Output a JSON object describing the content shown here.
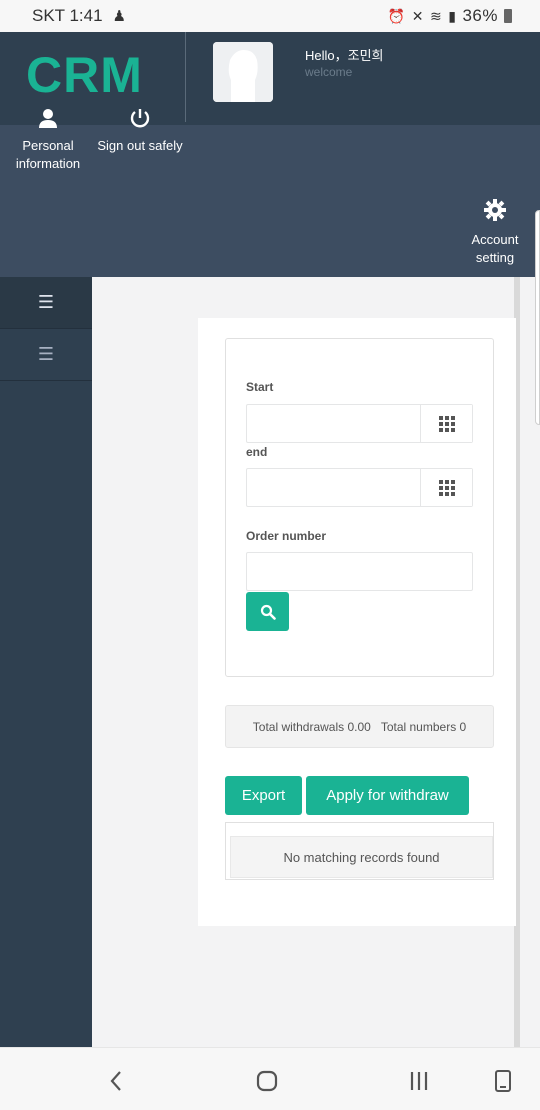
{
  "status": {
    "carrier_time": "SKT 1:41",
    "battery": "36%"
  },
  "header": {
    "logo": "CRM",
    "hello": "Hello，조민희",
    "welcome": "welcome",
    "personal_info": "Personal information",
    "sign_out": "Sign out safely",
    "account_setting": "Account setting"
  },
  "form": {
    "start_label": "Start",
    "end_label": "end",
    "order_label": "Order number",
    "start_value": "",
    "end_value": "",
    "order_value": ""
  },
  "totals": {
    "withdrawals": "Total withdrawals 0.00",
    "numbers": "Total numbers 0"
  },
  "actions": {
    "export": "Export",
    "apply": "Apply for withdraw"
  },
  "table": {
    "empty_message": "No matching records found"
  },
  "colors": {
    "accent": "#1ab394",
    "sidebar": "#2f4050",
    "subbar": "#3d4d61"
  }
}
